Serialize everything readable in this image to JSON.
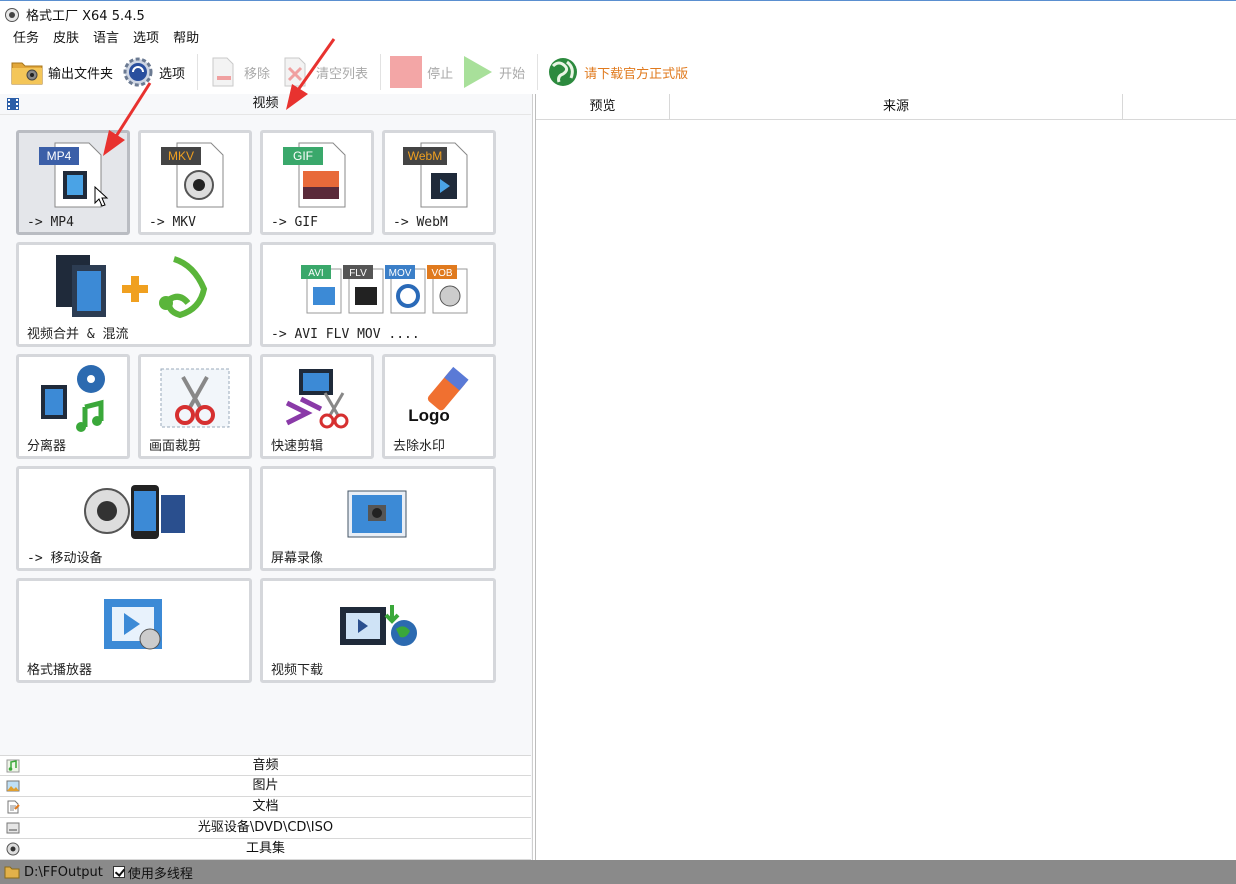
{
  "window": {
    "title": "格式工厂 X64 5.4.5"
  },
  "menu": [
    "任务",
    "皮肤",
    "语言",
    "选项",
    "帮助"
  ],
  "toolbar": {
    "output_folder": "输出文件夹",
    "options": "选项",
    "remove": "移除",
    "clear_list": "清空列表",
    "stop": "停止",
    "start": "开始",
    "download": "请下载官方正式版"
  },
  "sections": {
    "video": "视频",
    "audio": "音频",
    "image": "图片",
    "document": "文档",
    "disc": "光驱设备\\DVD\\CD\\ISO",
    "tools": "工具集"
  },
  "tiles": {
    "mp4": {
      "label": "-> MP4",
      "badge": "MP4"
    },
    "mkv": {
      "label": "-> MKV",
      "badge": "MKV"
    },
    "gif": {
      "label": "-> GIF",
      "badge": "GIF"
    },
    "webm": {
      "label": "-> WebM",
      "badge": "WebM"
    },
    "merge": {
      "label": "视频合并 & 混流"
    },
    "others": {
      "label": "-> AVI FLV MOV ....",
      "badges": [
        "AVI",
        "FLV",
        "MOV",
        "VOB"
      ]
    },
    "splitter": {
      "label": "分离器"
    },
    "crop": {
      "label": "画面裁剪"
    },
    "quick_edit": {
      "label": "快速剪辑"
    },
    "watermark": {
      "label": "去除水印",
      "logo_text": "Logo"
    },
    "mobile": {
      "label": "-> 移动设备"
    },
    "screen_record": {
      "label": "屏幕录像"
    },
    "player": {
      "label": "格式播放器"
    },
    "video_download": {
      "label": "视频下载"
    }
  },
  "grid": {
    "col_preview": "预览",
    "col_source": "来源"
  },
  "status": {
    "output_path": "D:\\FFOutput",
    "multithread": "使用多线程"
  },
  "colors": {
    "accent_red": "#e8322f",
    "download_orange": "#e07a1e",
    "status_bg": "#8a8a8a"
  }
}
